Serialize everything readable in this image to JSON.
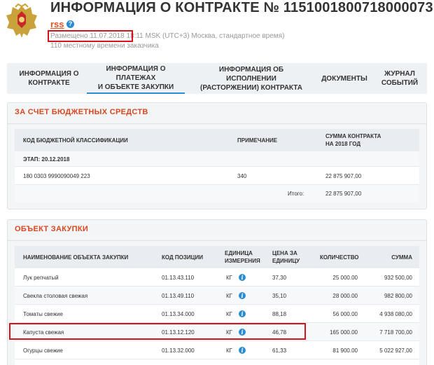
{
  "header": {
    "title": "ИНФОРМАЦИЯ О КОНТРАКТЕ № 1151001800718000073",
    "rss_label": "rss",
    "help_glyph": "?",
    "published_prefix": "Размещено ",
    "published_datetime": "11.07.2018 18:11",
    "published_suffix": " MSK (UTC+3) Москва, стандартное время)",
    "local_time_note": "110 местному времени заказчика"
  },
  "tabs": [
    {
      "line1": "ИНФОРМАЦИЯ О",
      "line2": "КОНТРАКТЕ"
    },
    {
      "line1": "ИНФОРМАЦИЯ О ПЛАТЕЖАХ",
      "line2": "И ОБЪЕКТЕ ЗАКУПКИ"
    },
    {
      "line1": "ИНФОРМАЦИЯ ОБ ИСПОЛНЕНИИ",
      "line2": "(РАСТОРЖЕНИИ) КОНТРАКТА"
    },
    {
      "line1": "ДОКУМЕНТЫ",
      "line2": ""
    },
    {
      "line1": "ЖУРНАЛ",
      "line2": "СОБЫТИЙ"
    }
  ],
  "budget": {
    "title": "ЗА СЧЕТ БЮДЖЕТНЫХ СРЕДСТВ",
    "col_code": "КОД БЮДЖЕТНОЙ КЛАССИФИКАЦИИ",
    "col_note": "ПРИМЕЧАНИЕ",
    "col_sum_line1": "СУММА КОНТРАКТА",
    "col_sum_line2": "НА 2018 ГОД",
    "stage": "ЭТАП: 20.12.2018",
    "code": "180 0303 9990090049 223",
    "note": "340",
    "sum": "22 875 907,00",
    "total_label": "Итого:",
    "total_value": "22 875 907,00"
  },
  "purchase": {
    "title": "ОБЪЕКТ ЗАКУПКИ",
    "headers": {
      "name": "НАИМЕНОВАНИЕ ОБЪЕКТА ЗАКУПКИ",
      "code": "КОД ПОЗИЦИИ",
      "unit_line1": "ЕДИНИЦА",
      "unit_line2": "ИЗМЕРЕНИЯ",
      "price_line1": "ЦЕНА ЗА",
      "price_line2": "ЕДИНИЦУ",
      "qty": "КОЛИЧЕСТВО",
      "sum": "СУММА"
    },
    "info_glyph": "i",
    "rows": [
      {
        "name": "Лук репчатый",
        "code": "01.13.43.110",
        "unit": "КГ",
        "price": "37,30",
        "qty": "25 000.00",
        "sum": "932 500,00"
      },
      {
        "name": "Свекла столовая свежая",
        "code": "01.13.49.110",
        "unit": "КГ",
        "price": "35,10",
        "qty": "28 000.00",
        "sum": "982 800,00"
      },
      {
        "name": "Томаты свежие",
        "code": "01.13.34.000",
        "unit": "КГ",
        "price": "88,18",
        "qty": "56 000.00",
        "sum": "4 938 080,00"
      },
      {
        "name": "Капуста свежая",
        "code": "01.13.12.120",
        "unit": "КГ",
        "price": "46,78",
        "qty": "165 000.00",
        "sum": "7 718 700,00"
      },
      {
        "name": "Огурцы свежие",
        "code": "01.13.32.000",
        "unit": "КГ",
        "price": "61,33",
        "qty": "81 900.00",
        "sum": "5 022 927,00"
      }
    ]
  },
  "colors": {
    "accent_orange": "#d8471f",
    "link_blue": "#2a8dd4",
    "highlight_red": "#d6121a"
  }
}
